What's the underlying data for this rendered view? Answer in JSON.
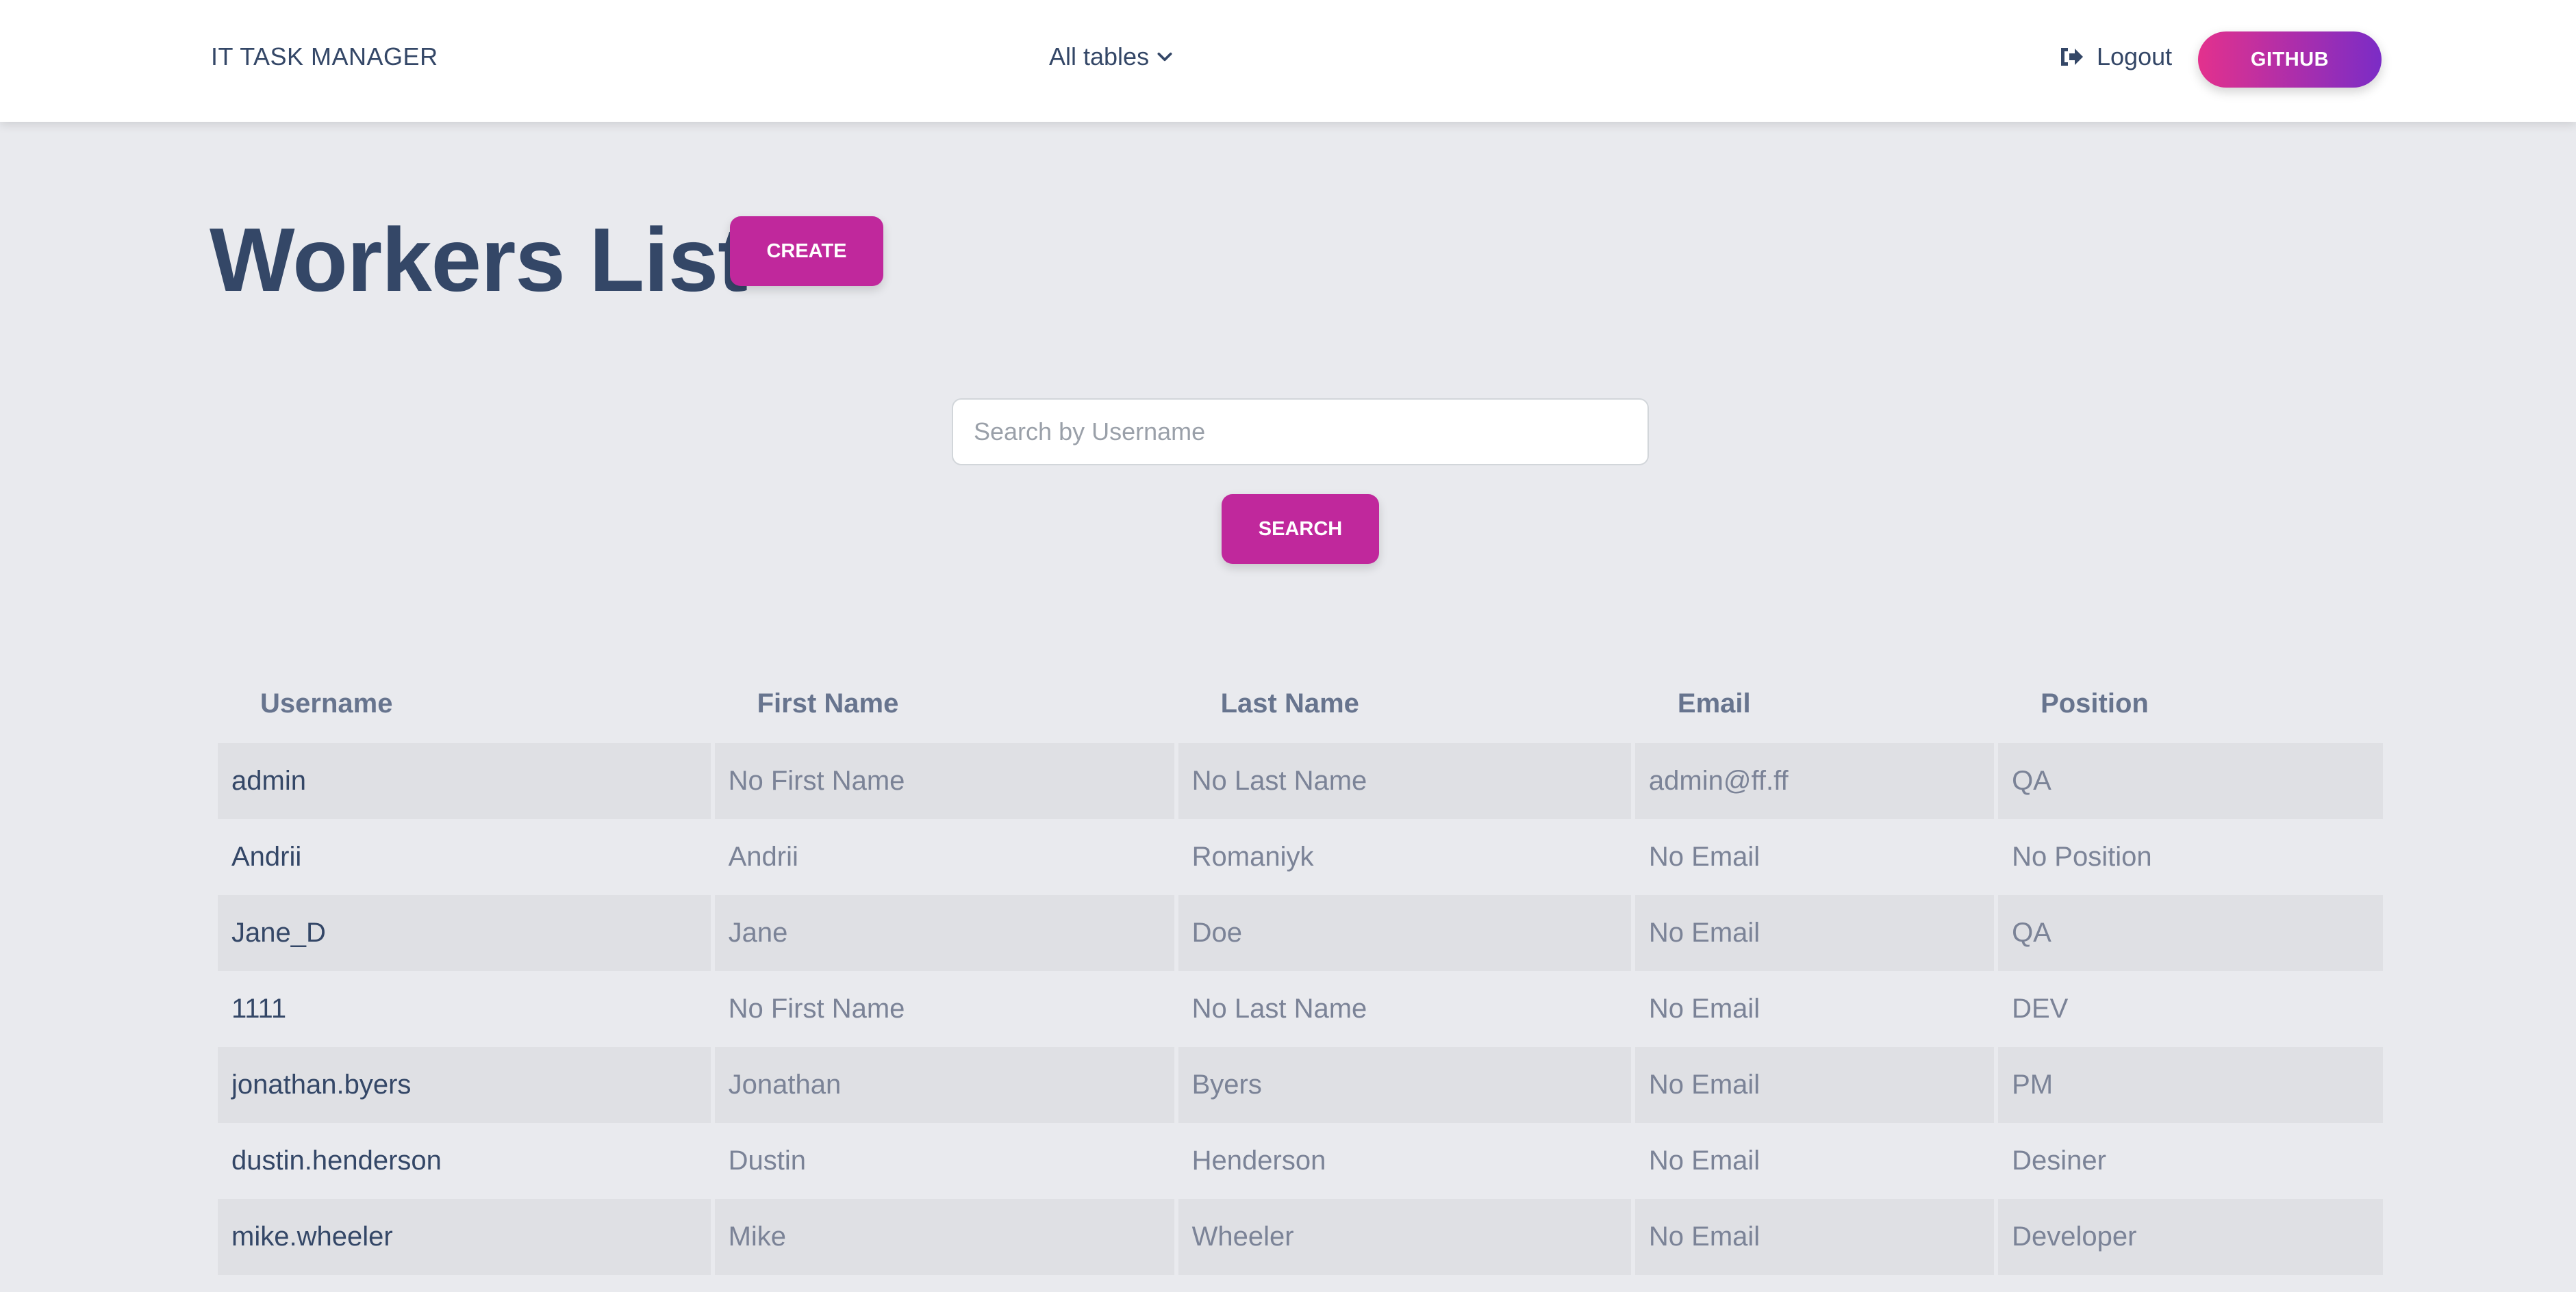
{
  "navbar": {
    "brand": "IT TASK MANAGER",
    "tables_dropdown": "All tables",
    "logout_label": "Logout",
    "github_label": "GITHUB"
  },
  "page": {
    "title": "Workers List",
    "create_label": "CREATE"
  },
  "search": {
    "placeholder": "Search by Username",
    "value": "",
    "button_label": "SEARCH"
  },
  "table": {
    "headers": [
      "Username",
      "First Name",
      "Last Name",
      "Email",
      "Position"
    ],
    "rows": [
      [
        "admin",
        "No First Name",
        "No Last Name",
        "admin@ff.ff",
        "QA"
      ],
      [
        "Andrii",
        "Andrii",
        "Romaniyk",
        "No Email",
        "No Position"
      ],
      [
        "Jane_D",
        "Jane",
        "Doe",
        "No Email",
        "QA"
      ],
      [
        "1111",
        "No First Name",
        "No Last Name",
        "No Email",
        "DEV"
      ],
      [
        "jonathan.byers",
        "Jonathan",
        "Byers",
        "No Email",
        "PM"
      ],
      [
        "dustin.henderson",
        "Dustin",
        "Henderson",
        "No Email",
        "Desiner"
      ],
      [
        "mike.wheeler",
        "Mike",
        "Wheeler",
        "No Email",
        "Developer"
      ]
    ]
  },
  "colors": {
    "accent": "#c0289c",
    "github_gradient_start": "#e3318d",
    "github_gradient_end": "#7b2cc6",
    "page_bg": "#e9eaee",
    "text_dark": "#344767"
  },
  "icons": {
    "dropdown": "chevron-down-icon",
    "logout": "sign-out-icon"
  }
}
